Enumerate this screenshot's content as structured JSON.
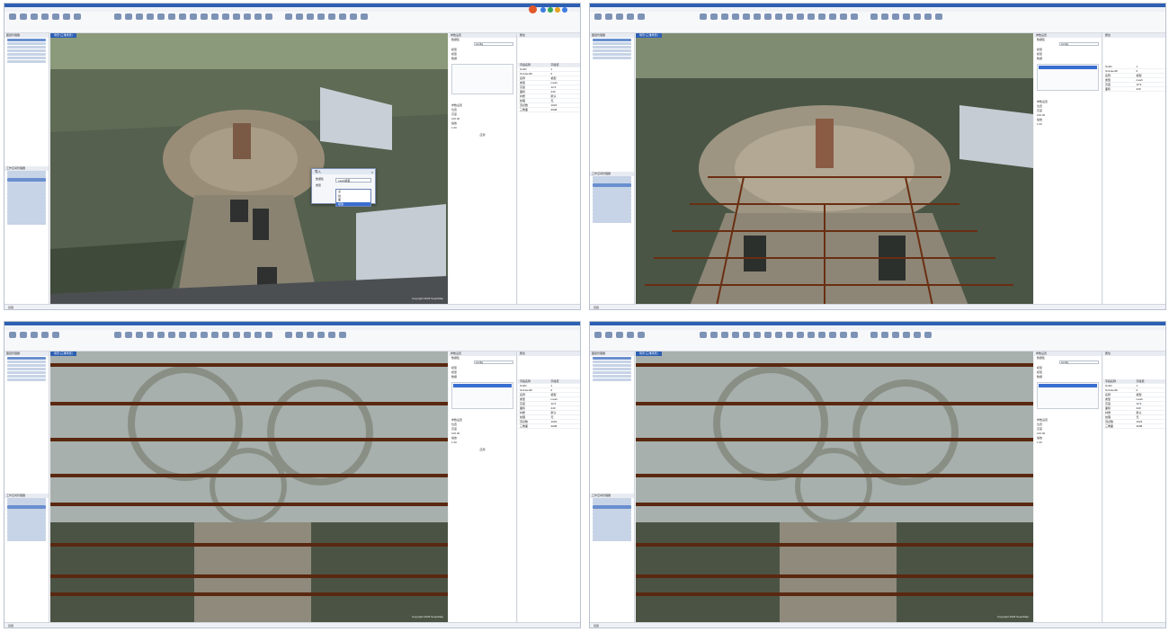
{
  "panels": {
    "project_tree_title": "图层管理器",
    "workspace_title": "工作空间管理器",
    "scene_title": "场景",
    "properties_title": "属性",
    "settings_title": "参数设置"
  },
  "view": {
    "doc_tab_1": "场景:[三维场景]",
    "doc_tab_2": "场景:[三维场景]",
    "doc_tab_3": "场景:[三维场景]",
    "doc_tab_4": "场景:[三维场景]",
    "copyright": "Copyright 2025 SuperMap"
  },
  "dialog": {
    "title": "导入",
    "close": "×",
    "field_label_1": "数据集",
    "field_label_2": "类型",
    "field_value_1": "mesh模型",
    "options": [
      "点",
      "线",
      "面",
      "模型"
    ],
    "selected_index": 3
  },
  "mid": {
    "label_1": "数据集",
    "label_2": "模型",
    "value_1": "config",
    "radio_1": "模型",
    "radio_2": "数据",
    "label_3": "参数设置",
    "label_4": "位置",
    "label_5": "高度",
    "value_5": "100.00",
    "label_6": "缩放",
    "value_6": "1.00",
    "apply": "应用"
  },
  "props": {
    "header": [
      "字段名称",
      "字段值"
    ],
    "rows": [
      [
        "SmID",
        "1"
      ],
      [
        "SmUserID",
        "0"
      ],
      [
        "名称",
        "模型"
      ],
      [
        "类型",
        "mesh"
      ],
      [
        "高度",
        "12.5"
      ],
      [
        "面积",
        "240"
      ],
      [
        "材质",
        "默认"
      ],
      [
        "纹理",
        "无"
      ],
      [
        "顶点数",
        "1024"
      ],
      [
        "三角面",
        "2048"
      ]
    ]
  },
  "statusbar": {
    "text_1": "就绪",
    "text_2": "就绪",
    "text_3": "就绪",
    "text_4": "就绪"
  },
  "colors": {
    "accent": "#2d5fb3",
    "logo": "#e2582a"
  }
}
